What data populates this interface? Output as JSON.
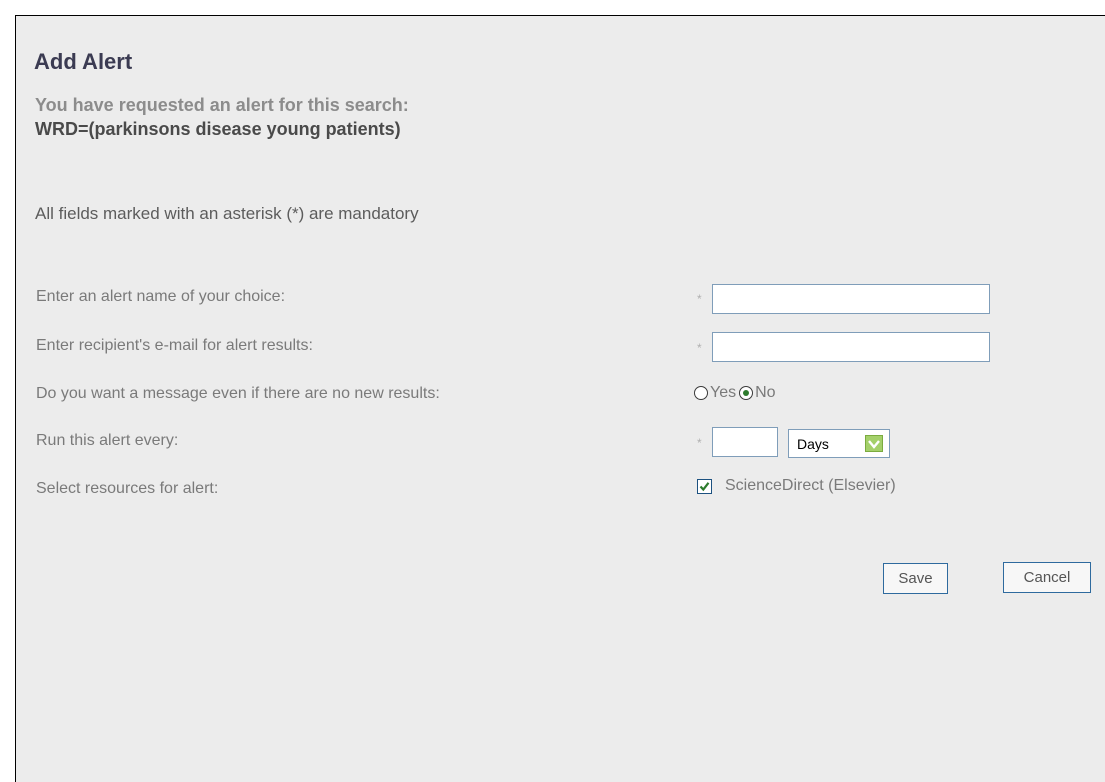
{
  "dialog": {
    "title": "Add Alert",
    "requested_label": "You have requested an alert for this search:",
    "query": "WRD=(parkinsons disease young patients)",
    "mandatory_note": "All fields marked with an asterisk (*) are mandatory"
  },
  "fields": {
    "alert_name": {
      "label": "Enter an alert name of your choice:",
      "required_marker": "*",
      "value": ""
    },
    "email": {
      "label": "Enter recipient's e-mail for alert results:",
      "required_marker": "*",
      "value": ""
    },
    "no_results_message": {
      "label": "Do you want a message even if there are no new results:",
      "options": [
        "Yes",
        "No"
      ],
      "selected": "No"
    },
    "frequency": {
      "label": "Run this alert every:",
      "required_marker": "*",
      "value": "",
      "unit": "Days"
    },
    "resources": {
      "label": "Select resources for alert:",
      "items": [
        {
          "label": "ScienceDirect (Elsevier)",
          "checked": true
        }
      ]
    }
  },
  "buttons": {
    "save": "Save",
    "cancel": "Cancel"
  },
  "colors": {
    "panel_background": "#ececec",
    "title": "#3b3b52",
    "label": "#7a7a7a",
    "input_border": "#7f9db9",
    "button_border": "#2e6a9e",
    "check_green": "#2d7b2d",
    "select_arrow": "#a4d06a"
  },
  "icons": {
    "select_arrow": "chevron-down-icon",
    "checkbox_mark": "checkmark-icon"
  }
}
